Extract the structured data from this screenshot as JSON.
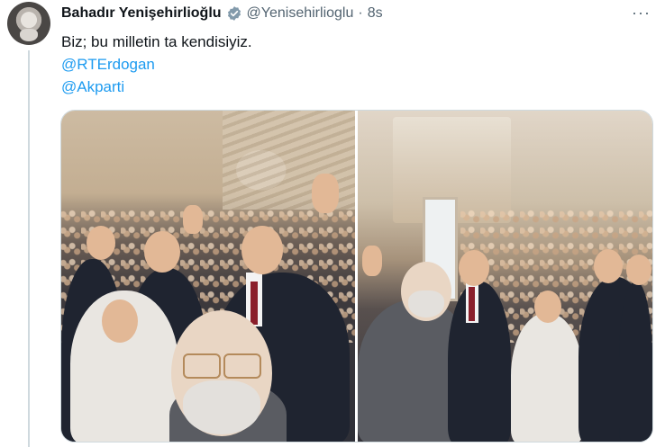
{
  "author": {
    "name": "Bahadır Yenişehirlioğlu",
    "handle": "@Yenisehirlioglu",
    "separator": "·",
    "time": "8s",
    "verified": true
  },
  "tweet": {
    "text": "Biz; bu milletin ta kendisiyiz.",
    "mentions": [
      "@RTErdogan",
      "@Akparti"
    ]
  },
  "actions": {
    "more_label": "···"
  },
  "media": {
    "count": 2,
    "images": [
      {
        "alt_name": "selfie-photo-left"
      },
      {
        "alt_name": "selfie-photo-right"
      }
    ]
  },
  "colors": {
    "link": "#1d9bf0",
    "secondary_text": "#536471",
    "verified_badge": "#829aab",
    "border": "#cfd9de"
  }
}
